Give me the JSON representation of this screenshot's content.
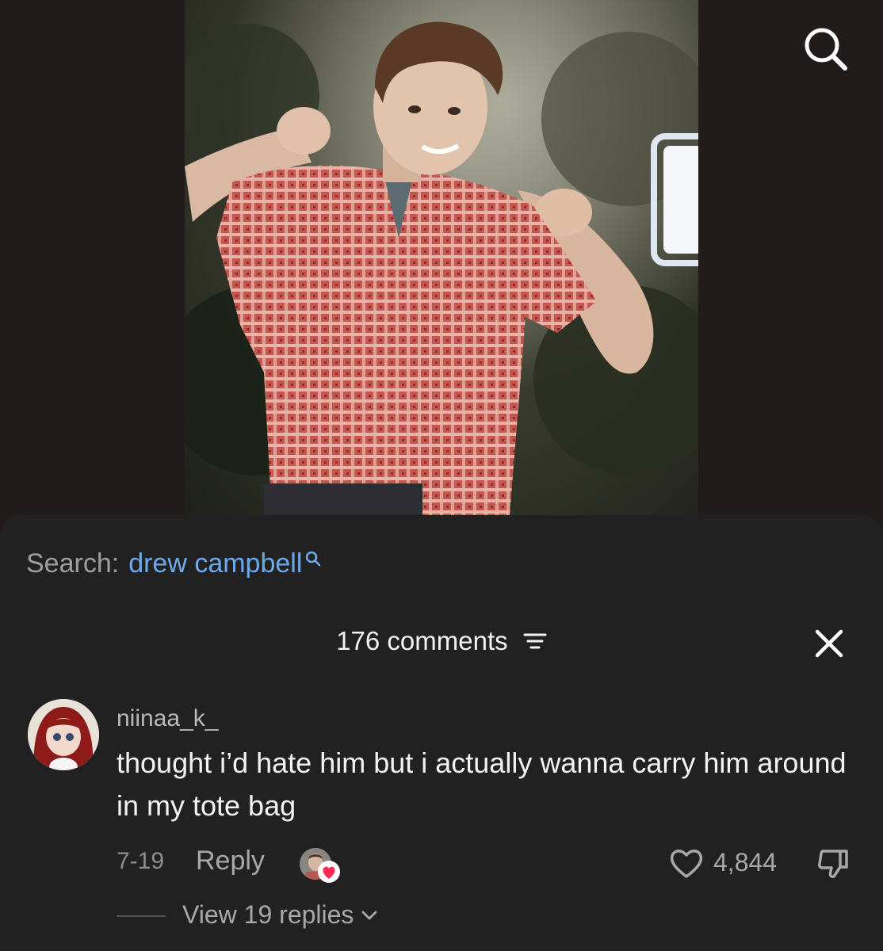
{
  "icons": {
    "top_search": "search-icon",
    "inline_search": "search-icon",
    "sort": "sort-icon",
    "close": "close-icon",
    "like": "heart-icon",
    "dislike": "thumbs-down-icon",
    "expand": "chevron-down-icon",
    "creator_like_badge": "heart-badge-icon"
  },
  "colors": {
    "background": "#221b1b",
    "sheet": "#212121",
    "search_term": "#6ea9ec",
    "creator_heart": "#fe2c55"
  },
  "search": {
    "label": "Search:",
    "term": "drew campbell"
  },
  "comments": {
    "count_label": "176 comments"
  },
  "comment": {
    "username": "niinaa_k_",
    "text": "thought i’d hate him but i actually wanna carry him around in my tote bag",
    "date": "7-19",
    "reply_label": "Reply",
    "likes": "4,844",
    "view_replies_label": "View 19 replies"
  }
}
